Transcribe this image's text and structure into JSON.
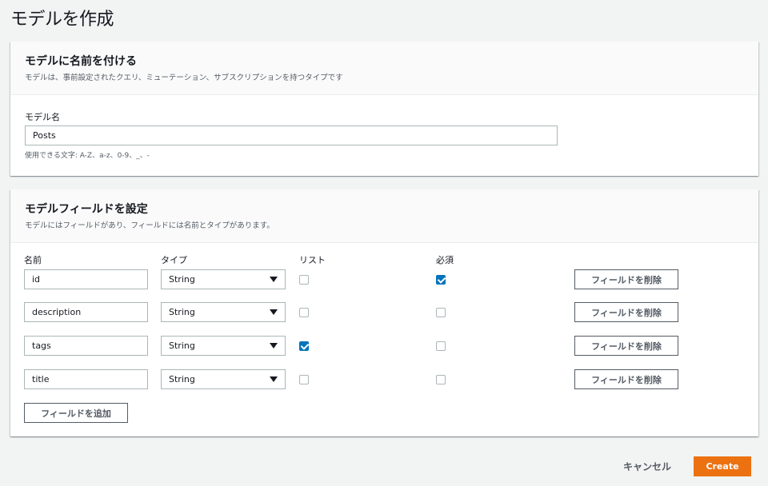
{
  "page": {
    "title": "モデルを作成"
  },
  "name_panel": {
    "title": "モデルに名前を付ける",
    "description": "モデルは、事前設定されたクエリ、ミューテーション、サブスクリプションを持つタイプです",
    "field_label": "モデル名",
    "field_value": "Posts",
    "hint": "使用できる文字: A-Z、a-z、0-9、_、-"
  },
  "fields_panel": {
    "title": "モデルフィールドを設定",
    "description": "モデルにはフィールドがあり、フィールドには名前とタイプがあります。",
    "columns": {
      "name": "名前",
      "type": "タイプ",
      "list": "リスト",
      "required": "必須"
    },
    "rows": [
      {
        "name": "id",
        "type": "String",
        "list": false,
        "required": true,
        "remove_label": "フィールドを削除"
      },
      {
        "name": "description",
        "type": "String",
        "list": false,
        "required": false,
        "remove_label": "フィールドを削除"
      },
      {
        "name": "tags",
        "type": "String",
        "list": true,
        "required": false,
        "remove_label": "フィールドを削除"
      },
      {
        "name": "title",
        "type": "String",
        "list": false,
        "required": false,
        "remove_label": "フィールドを削除"
      }
    ],
    "add_label": "フィールドを追加"
  },
  "footer": {
    "cancel_label": "キャンセル",
    "create_label": "Create"
  },
  "colors": {
    "accent": "#ec7211",
    "checkbox": "#0073bb"
  }
}
